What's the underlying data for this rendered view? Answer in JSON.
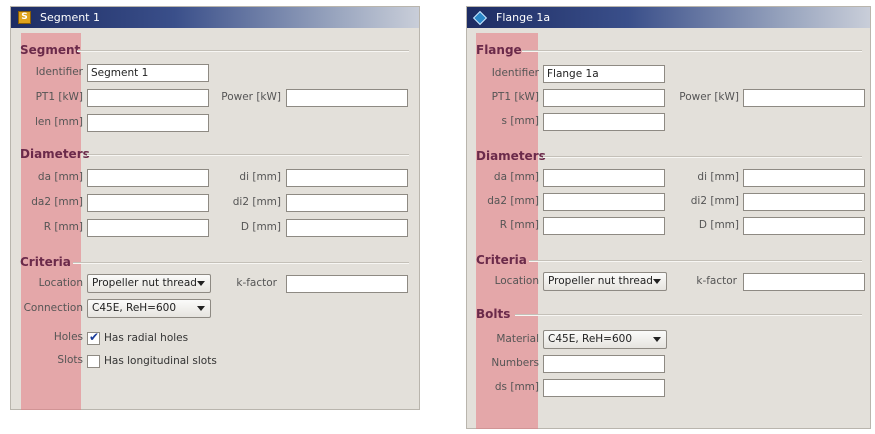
{
  "segment": {
    "window_title": "Segment 1",
    "icon_glyph": "S",
    "sections": {
      "segment": "Segment",
      "diameters": "Diameters",
      "criteria": "Criteria"
    },
    "labels": {
      "identifier": "Identifier",
      "pt1": "PT1 [kW]",
      "power": "Power [kW]",
      "len": "len [mm]",
      "da": "da [mm]",
      "di": "di [mm]",
      "da2": "da2 [mm]",
      "di2": "di2 [mm]",
      "r": "R [mm]",
      "d": "D [mm]",
      "location": "Location",
      "kfactor": "k-factor",
      "connection": "Connection",
      "holes": "Holes",
      "slots": "Slots"
    },
    "values": {
      "identifier": "Segment 1",
      "location": "Propeller nut thread",
      "connection": "C45E, ReH=600"
    },
    "checkboxes": {
      "holes_label": "Has radial holes",
      "holes_checked": true,
      "slots_label": "Has longitudinal slots",
      "slots_checked": false
    }
  },
  "flange": {
    "window_title": "Flange 1a",
    "sections": {
      "flange": "Flange",
      "diameters": "Diameters",
      "criteria": "Criteria",
      "bolts": "Bolts"
    },
    "labels": {
      "identifier": "Identifier",
      "pt1": "PT1 [kW]",
      "power": "Power [kW]",
      "s": "s [mm]",
      "da": "da [mm]",
      "di": "di [mm]",
      "da2": "da2 [mm]",
      "di2": "di2 [mm]",
      "r": "R [mm]",
      "d": "D [mm]",
      "location": "Location",
      "kfactor": "k-factor",
      "material": "Material",
      "numbers": "Numbers",
      "ds": "ds [mm]"
    },
    "values": {
      "identifier": "Flange 1a",
      "location": "Propeller nut thread",
      "material": "C45E, ReH=600"
    }
  },
  "colors": {
    "highlight": "#e6787f",
    "title_bar": "#1d2c63",
    "section_text": "#6b2a4a"
  },
  "icons": {
    "segment": "segment-icon",
    "flange": "flange-diamond-icon",
    "check": "checkmark-icon",
    "dropdown": "chevron-down-icon"
  }
}
